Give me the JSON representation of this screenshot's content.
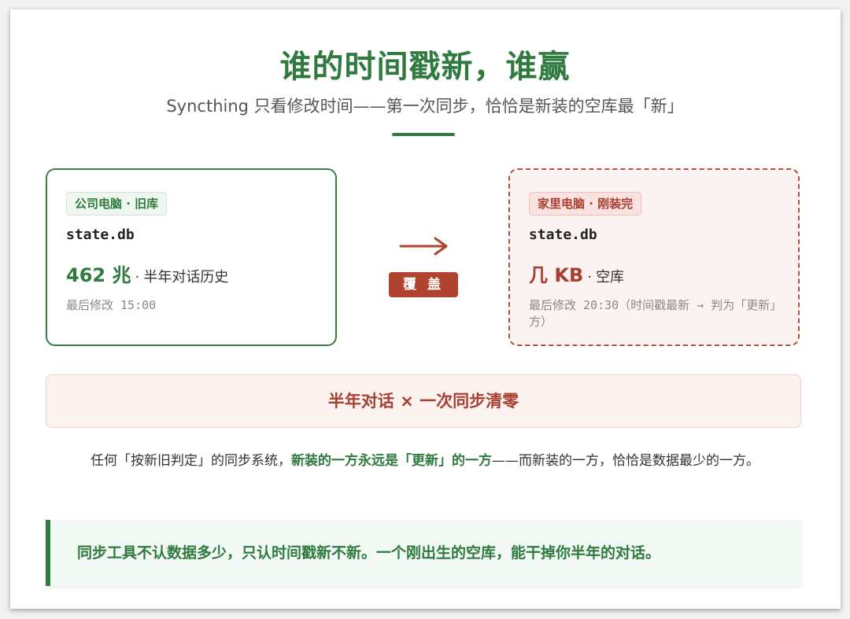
{
  "header": {
    "title": "谁的时间戳新，谁赢",
    "subtitle": "Syncthing 只看修改时间——第一次同步，恰恰是新装的空库最「新」"
  },
  "left_box": {
    "tag": "公司电脑 · 旧库",
    "filename": "state.db",
    "size": "462 兆",
    "separator": "·",
    "description": "半年对话历史",
    "mtime": "最后修改 15:00"
  },
  "middle": {
    "button_label": "覆 盖"
  },
  "right_box": {
    "tag": "家里电脑 · 刚装完",
    "filename": "state.db",
    "size": "几 KB",
    "separator": "·",
    "description": "空库",
    "mtime": "最后修改 20:30（时间戳最新 → 判为「更新」方）"
  },
  "banner": {
    "text": "半年对话 × 一次同步清零"
  },
  "paragraph": {
    "part1": "任何「按新旧判定」的同步系统，",
    "highlight": "新装的一方永远是「更新」的一方",
    "part2": "——而新装的一方，恰恰是数据最少的一方。"
  },
  "quote": {
    "text": "同步工具不认数据多少，只认时间戳新不新。一个刚出生的空库，能干掉你半年的对话。"
  },
  "colors": {
    "green": "#2f7a3e",
    "red": "#a83f30",
    "button_red": "#b0432f"
  },
  "icons": {
    "arrow": "right-arrow-icon"
  }
}
